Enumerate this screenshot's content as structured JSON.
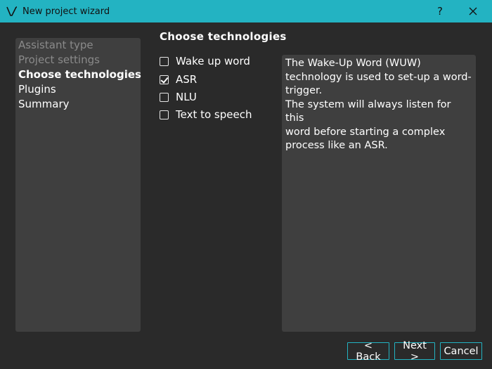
{
  "window": {
    "title": "New project wizard",
    "help_label": "?",
    "close_label": "✕"
  },
  "steps": [
    {
      "label": "Assistant type",
      "state": "done"
    },
    {
      "label": "Project settings",
      "state": "done"
    },
    {
      "label": "Choose technologies",
      "state": "current"
    },
    {
      "label": "Plugins",
      "state": "todo"
    },
    {
      "label": "Summary",
      "state": "todo"
    }
  ],
  "page": {
    "title": "Choose technologies",
    "options": [
      {
        "label": "Wake up word",
        "checked": false
      },
      {
        "label": "ASR",
        "checked": true
      },
      {
        "label": "NLU",
        "checked": false
      },
      {
        "label": "Text to speech",
        "checked": false
      }
    ],
    "description": "The Wake-Up Word (WUW)\ntechnology is used to set-up a word-\ntrigger.\nThe system will always listen for this\nword before starting a complex\nprocess like an ASR."
  },
  "buttons": {
    "back": "< Back",
    "next": "Next >",
    "cancel": "Cancel"
  },
  "colors": {
    "accent": "#23b3c2",
    "background": "#2a2a2a",
    "panel": "#3f3f3f"
  }
}
